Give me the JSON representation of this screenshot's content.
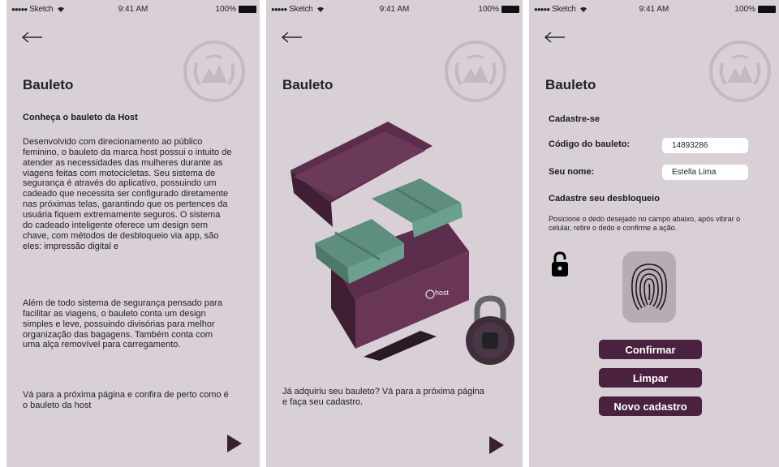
{
  "status_bar": {
    "carrier": "Sketch",
    "time": "9:41 AM",
    "battery": "100%"
  },
  "screen1": {
    "title": "Bauleto",
    "subtitle": "Conheça o bauleto da Host",
    "paragraph1": "Desenvolvido com direcionamento ao público feminino, o bauleto da marca host possui o intuito de atender as necessidades das mulheres durante as viagens feitas com motocicletas. Seu sistema de segurança é através do aplicativo, possuindo um cadeado que necessita ser configurado diretamente nas próximas telas, garantindo que os pertences da usuária fiquem extremamente seguros. O sistema do cadeado inteligente oferece um design sem chave, com métodos de desbloqueio via app, são eles: impressão digital e",
    "paragraph2": "Além de todo sistema de segurança pensado para facilitar as viagens, o bauleto conta um design simples e leve, possuindo divisórias para melhor organização das bagagens. Também conta com uma alça removível para carregamento.",
    "paragraph3": "Vá para a próxima página e confira de perto como é o bauleto da host"
  },
  "screen2": {
    "title": "Bauleto",
    "product_brand": "host",
    "caption": "Já adquiriu seu bauleto? Vá para a próxima página e faça seu cadastro."
  },
  "screen3": {
    "title": "Bauleto",
    "section_register": "Cadastre-se",
    "code_label": "Código do bauleto:",
    "code_value": "14893286",
    "name_label": "Seu nome:",
    "name_value": "Estella Lima",
    "section_unlock": "Cadastre seu desbloqueio",
    "hint": "Posicione o dedo desejado no campo abaixo, após vibrar o celular, retire o dedo e confirme a ação.",
    "confirm_label": "Confirmar",
    "clear_label": "Limpar",
    "new_label": "Novo cadastro"
  },
  "colors": {
    "background": "#d9cfd6",
    "button": "#4a2240",
    "accent": "#3b1f33"
  },
  "icons": [
    "back-arrow-icon",
    "brand-logo-icon",
    "play-icon",
    "padlock-icon",
    "fingerprint-icon",
    "wifi-icon",
    "battery-icon"
  ]
}
